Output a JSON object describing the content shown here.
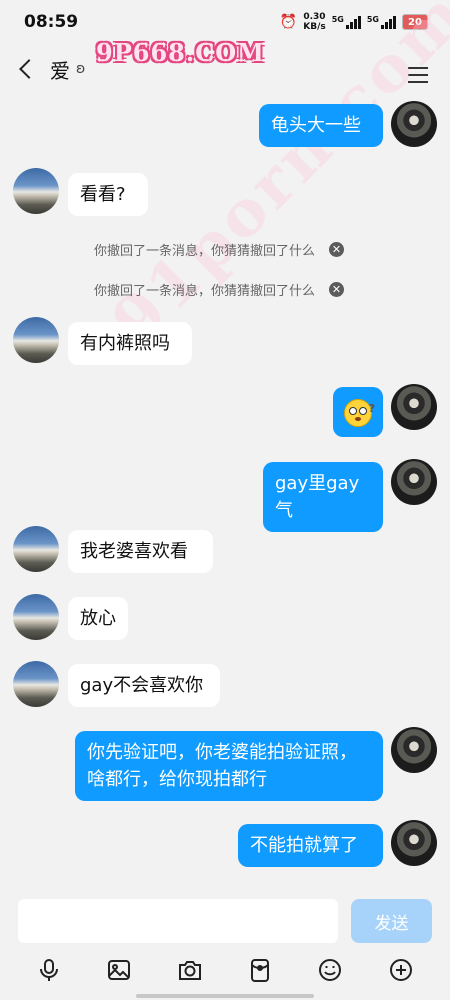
{
  "status_bar": {
    "time": "08:59",
    "net_speed_value": "0.30",
    "net_speed_unit": "KB/s",
    "signal1_label": "5G",
    "signal2_label": "5G",
    "battery_level": "20",
    "battery_color": "#e35a5a"
  },
  "header": {
    "title": "爱",
    "watermark": "9P668.COM"
  },
  "watermark_diag": "91porn.com",
  "messages": [
    {
      "side": "out",
      "text": "龟头大一些"
    },
    {
      "side": "in",
      "text": "看看?"
    },
    {
      "type": "recall",
      "text": "你撤回了一条消息，你猜猜撤回了什么"
    },
    {
      "type": "recall",
      "text": "你撤回了一条消息，你猜猜撤回了什么"
    },
    {
      "side": "in",
      "text": "有内裤照吗"
    },
    {
      "side": "out",
      "type": "emoji",
      "icon": "confused-face-emoji"
    },
    {
      "side": "out",
      "text": "gay里gay气"
    },
    {
      "side": "in",
      "text": "我老婆喜欢看"
    },
    {
      "side": "in",
      "text": "放心"
    },
    {
      "side": "in",
      "text": "gay不会喜欢你"
    },
    {
      "side": "out",
      "text": "你先验证吧，你老婆能拍验证照，啥都行，给你现拍都行"
    },
    {
      "side": "out",
      "text": "不能拍就算了"
    }
  ],
  "input": {
    "placeholder": "",
    "send_label": "发送"
  },
  "toolbar": {
    "icons": [
      "microphone-icon",
      "image-icon",
      "camera-icon",
      "red-packet-icon",
      "emoji-icon",
      "plus-icon"
    ]
  },
  "colors": {
    "background": "#f2f2f2",
    "outgoing_bubble": "#0f9bff",
    "incoming_bubble": "#ffffff",
    "send_button": "#a7d3fb"
  }
}
